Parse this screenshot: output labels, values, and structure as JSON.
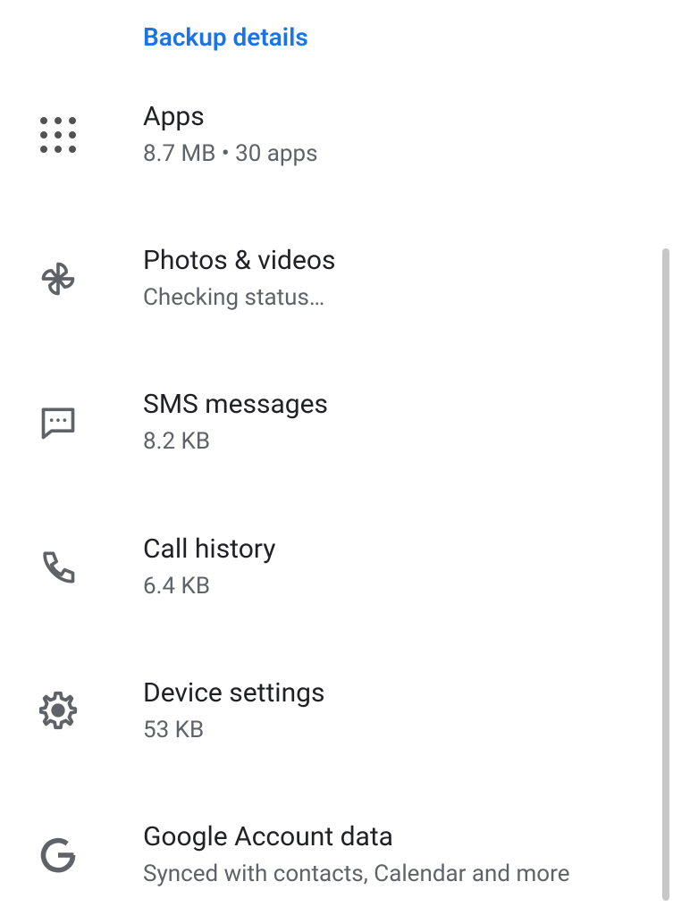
{
  "section_title": "Backup details",
  "items": {
    "apps": {
      "title": "Apps",
      "sub": "8.7 MB • 30 apps"
    },
    "photos": {
      "title": "Photos & videos",
      "sub": "Checking status…"
    },
    "sms": {
      "title": "SMS messages",
      "sub": "8.2 KB"
    },
    "call": {
      "title": "Call history",
      "sub": "6.4 KB"
    },
    "device": {
      "title": "Device settings",
      "sub": "53 KB"
    },
    "google": {
      "title": "Google Account data",
      "sub": "Synced with contacts, Calendar and more"
    }
  }
}
